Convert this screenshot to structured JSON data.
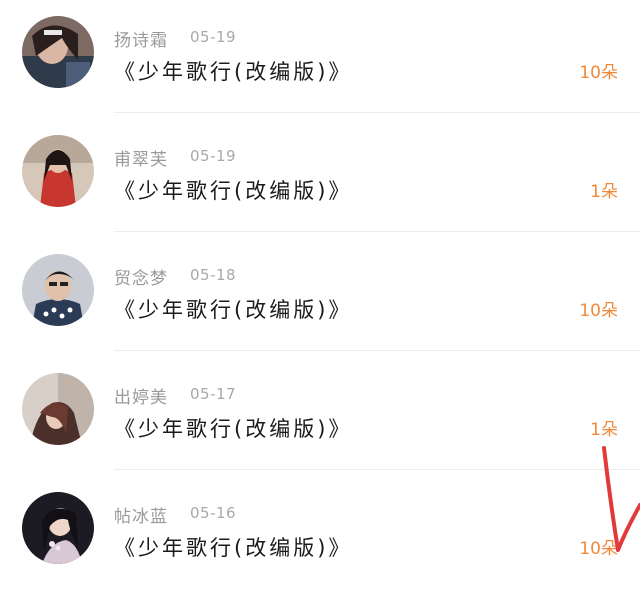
{
  "gifts": [
    {
      "name": "扬诗霜",
      "date": "05-19",
      "title": "《少年歌行(改编版)》",
      "count": "10朵",
      "avatar": "user-avatar-photo"
    },
    {
      "name": "甫翠芙",
      "date": "05-19",
      "title": "《少年歌行(改编版)》",
      "count": "1朵",
      "avatar": "user-avatar-photo"
    },
    {
      "name": "贸念梦",
      "date": "05-18",
      "title": "《少年歌行(改编版)》",
      "count": "10朵",
      "avatar": "user-avatar-photo"
    },
    {
      "name": "出婷美",
      "date": "05-17",
      "title": "《少年歌行(改编版)》",
      "count": "1朵",
      "avatar": "user-avatar-photo"
    },
    {
      "name": "帖冰蓝",
      "date": "05-16",
      "title": "《少年歌行(改编版)》",
      "count": "10朵",
      "avatar": "user-avatar-photo"
    }
  ],
  "colors": {
    "count": "#f08a3a",
    "name": "#9a9a9a",
    "title": "#1b1b1b",
    "annotation": "#e23a3a"
  }
}
